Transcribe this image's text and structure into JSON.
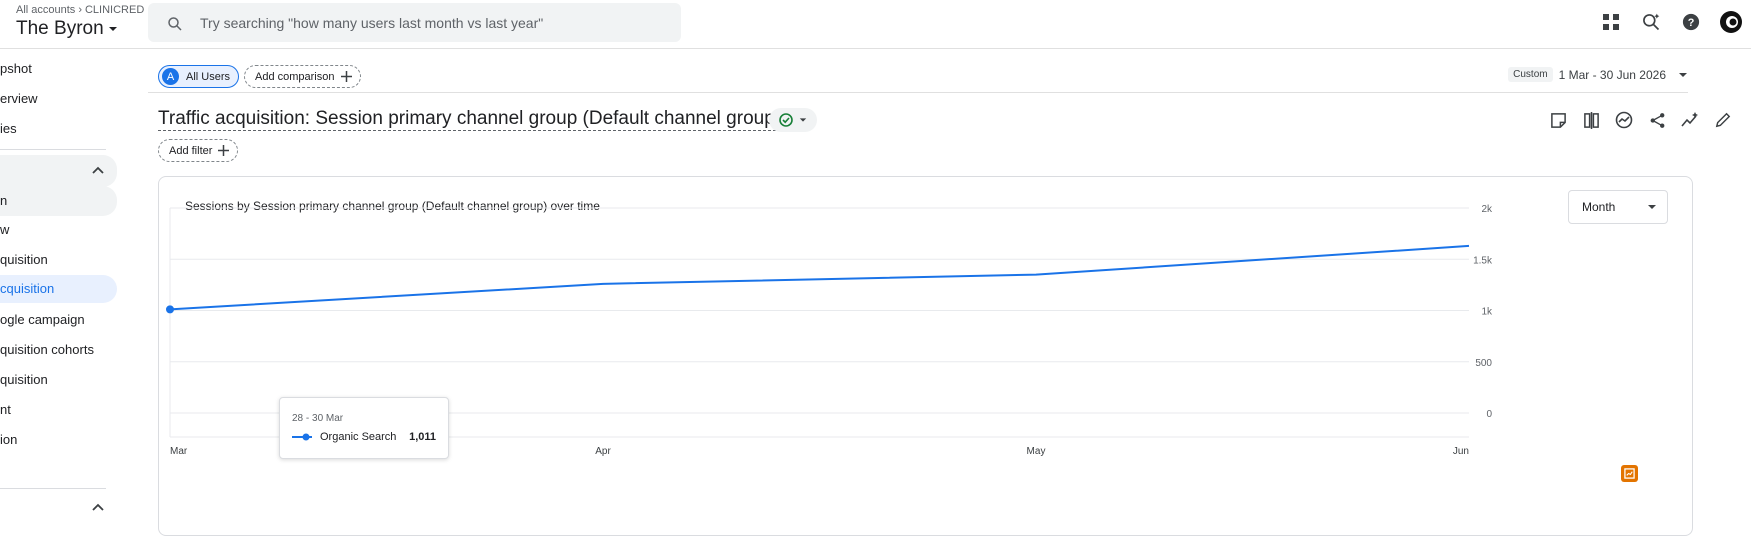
{
  "header": {
    "breadcrumb_all": "All accounts",
    "breadcrumb_account": "CLINICRED",
    "property_name": "The Byron",
    "search_placeholder": "Try searching \"how many users last month vs last year\""
  },
  "sidebar": {
    "items": [
      {
        "label": "pshot"
      },
      {
        "label": "erview"
      },
      {
        "label": "ies"
      },
      {
        "label": "n"
      },
      {
        "label": "w"
      },
      {
        "label": "quisition"
      },
      {
        "label": "cquisition"
      },
      {
        "label": "ogle campaign"
      },
      {
        "label": "quisition cohorts"
      },
      {
        "label": "quisition"
      },
      {
        "label": "nt"
      },
      {
        "label": "ion"
      }
    ]
  },
  "comparison": {
    "segment_badge": "A",
    "segment_label": "All Users",
    "add_comparison": "Add comparison",
    "date_custom": "Custom",
    "date_range": "1 Mar - 30 Jun 2026"
  },
  "report": {
    "title": "Traffic acquisition: Session primary channel group (Default channel group)",
    "add_filter": "Add filter"
  },
  "chart_card": {
    "title": "Sessions by Session primary channel group (Default channel group) over time",
    "granularity": "Month",
    "tooltip": {
      "date": "28 - 30 Mar",
      "series": "Organic Search",
      "value": "1,011"
    }
  },
  "colors": {
    "accent": "#1a73e8",
    "line": "#1a73e8",
    "insight": "#e37400"
  },
  "chart_data": {
    "type": "line",
    "x": [
      "Mar",
      "Apr",
      "May",
      "Jun"
    ],
    "x_tick_labels": [
      "Mar",
      "Apr",
      "May",
      "Jun"
    ],
    "y_tick_labels": [
      "0",
      "500",
      "1k",
      "1.5k",
      "2k"
    ],
    "ylim": [
      0,
      2000
    ],
    "series": [
      {
        "name": "Organic Search",
        "values": [
          1011,
          1260,
          1350,
          1630
        ]
      }
    ],
    "grid": true
  }
}
